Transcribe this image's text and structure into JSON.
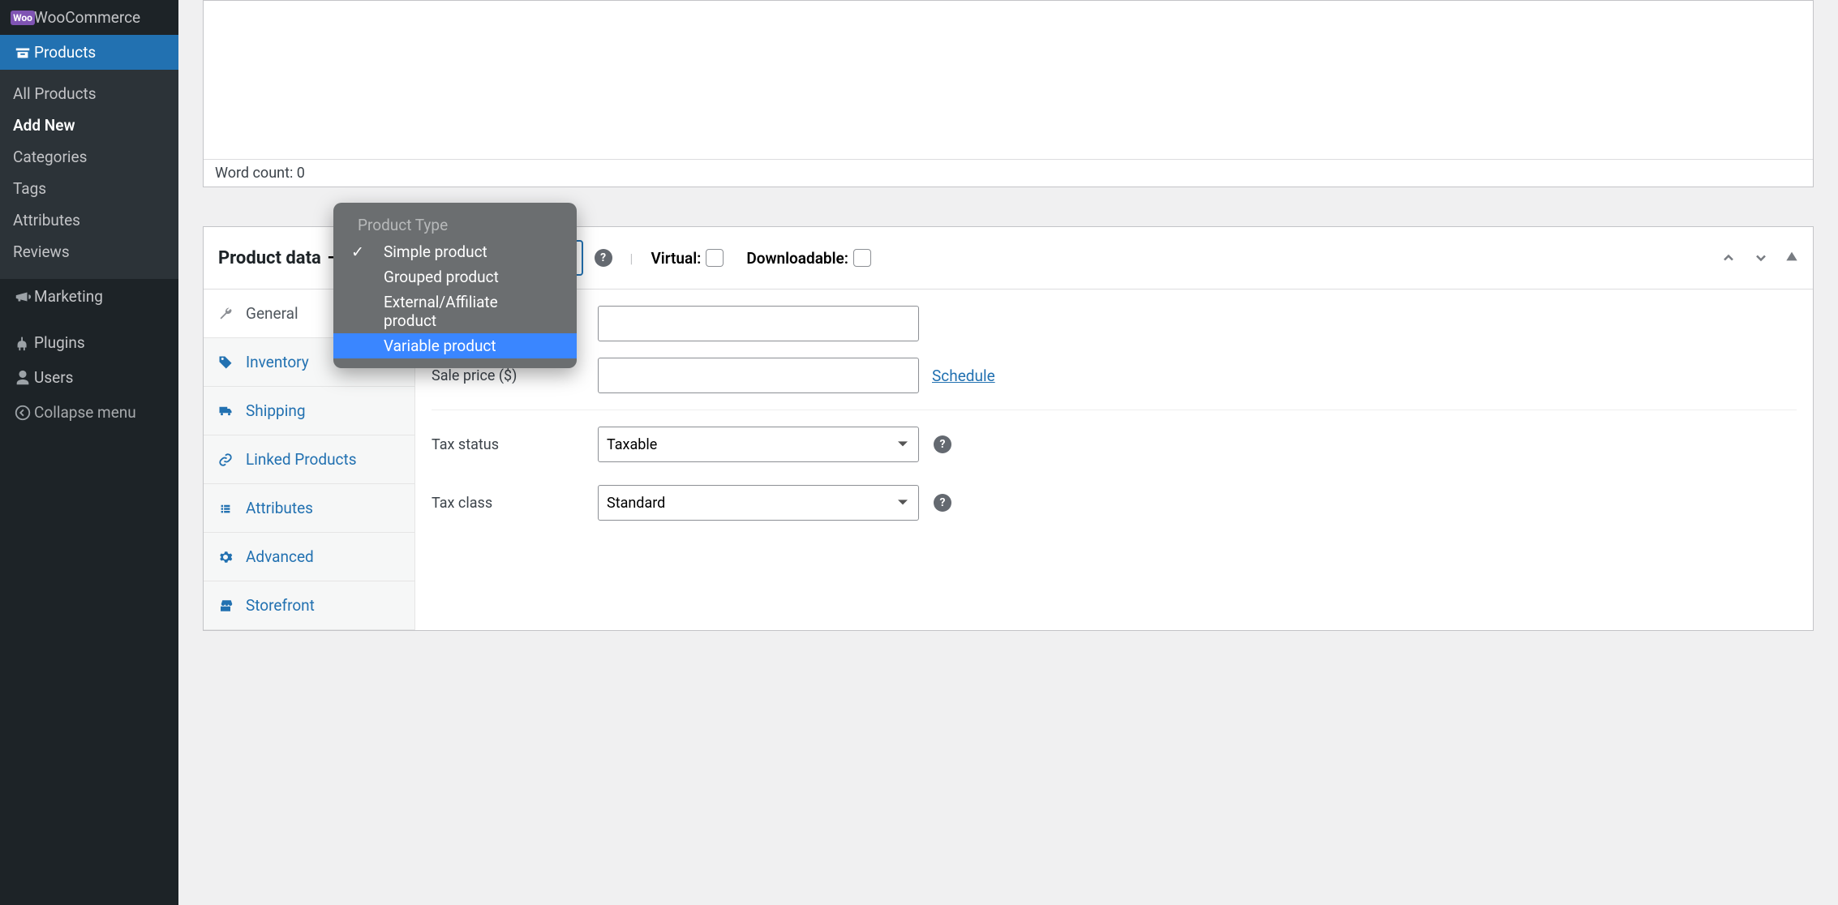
{
  "sidebar": {
    "woocommerce": "WooCommerce",
    "products": "Products",
    "sub": {
      "all_products": "All Products",
      "add_new": "Add New",
      "categories": "Categories",
      "tags": "Tags",
      "attributes": "Attributes",
      "reviews": "Reviews"
    },
    "marketing": "Marketing",
    "plugins": "Plugins",
    "users": "Users",
    "collapse": "Collapse menu"
  },
  "editor": {
    "word_count": "Word count: 0"
  },
  "panel": {
    "title": "Product data",
    "dash": " —",
    "virtual_label": "Virtual:",
    "downloadable_label": "Downloadable:"
  },
  "tabs": {
    "general": "General",
    "inventory": "Inventory",
    "shipping": "Shipping",
    "linked": "Linked Products",
    "attributes": "Attributes",
    "advanced": "Advanced",
    "storefront": "Storefront"
  },
  "fields": {
    "sale_price_label": "Sale price ($)",
    "schedule": "Schedule",
    "tax_status_label": "Tax status",
    "tax_status_value": "Taxable",
    "tax_class_label": "Tax class",
    "tax_class_value": "Standard"
  },
  "dropdown": {
    "header": "Product Type",
    "simple": "Simple product",
    "grouped": "Grouped product",
    "external": "External/Affiliate product",
    "variable": "Variable product"
  }
}
